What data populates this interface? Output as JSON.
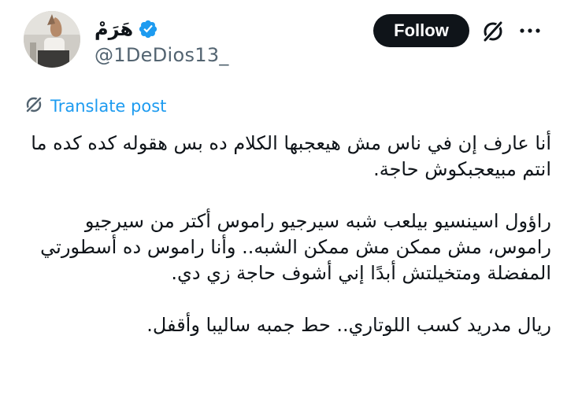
{
  "author": {
    "display_name": "هَرَمْ",
    "handle": "@1DeDios13_",
    "verified": true
  },
  "actions": {
    "follow_label": "Follow",
    "grok_icon": "grok-icon",
    "more_icon": "more-dots-icon"
  },
  "translate": {
    "label": "Translate post",
    "icon": "translate-icon"
  },
  "tweet": {
    "paragraphs": [
      "أنا عارف إن في ناس مش هيعجبها الكلام ده بس هقوله كده كده ما انتم مبيعجبكوش حاجة.",
      "راؤول اسينسيو بيلعب شبه سيرجيو راموس أكتر من سيرجيو راموس، مش ممكن مش ممكن الشبه.. وأنا راموس ده أسطورتي المفضلة ومتخيلتش أبدًا إني أشوف حاجة زي دي.",
      "ريال مدريد كسب اللوتاري.. حط جمبه ساليبا وأقفل."
    ]
  },
  "colors": {
    "text": "#0f1419",
    "secondary": "#536471",
    "link": "#1d9bf0",
    "verified": "#1d9bf0",
    "follow_bg": "#0f1419"
  }
}
